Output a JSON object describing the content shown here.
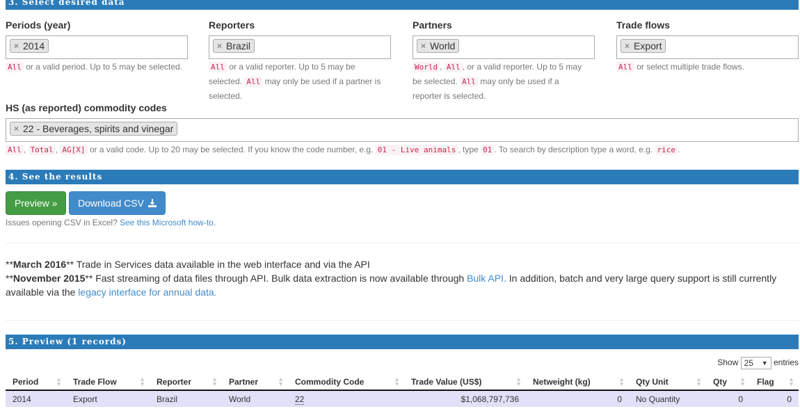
{
  "section3": {
    "title": "3. Select desired data"
  },
  "periods": {
    "label": "Periods (year)",
    "chip": "2014",
    "help_code": "All",
    "help_text": "or a valid period. Up to 5 may be selected."
  },
  "reporters": {
    "label": "Reporters",
    "chip": "Brazil",
    "help_code1": "All",
    "help_text1": "or a valid reporter. Up to 5 may be",
    "help_text2": "selected.",
    "help_code2": "All",
    "help_text3": "may only be used if a partner is",
    "help_text4": "selected."
  },
  "partners": {
    "label": "Partners",
    "chip": "World",
    "help_code1": "World",
    "help_sep1": ",",
    "help_code2": "All",
    "help_text1": ", or a valid reporter. Up to 5 may",
    "help_text2": "be selected.",
    "help_code3": "All",
    "help_text3": "may only be used if a",
    "help_text4": "reporter is selected."
  },
  "tradeflows": {
    "label": "Trade flows",
    "chip": "Export",
    "help_code": "All",
    "help_text": "or select multiple trade flows."
  },
  "hs": {
    "label": "HS (as reported) commodity codes",
    "chip": "22 - Beverages, spirits and vinegar",
    "help": {
      "c1": "All",
      "s1": ",",
      "c2": "Total",
      "s2": ",",
      "c3": "AG[X]",
      "t1": "or a valid code. Up to 20 may be selected. If you know the code number, e.g.",
      "c4": "01 - Live animals",
      "t2": ", type",
      "c5": "01",
      "t3": ". To search by description type a word, e.g.",
      "c6": "rice",
      "t4": "."
    }
  },
  "section4": {
    "title": "4. See the results"
  },
  "buttons": {
    "preview": "Preview »",
    "download": "Download CSV"
  },
  "csv_note": {
    "text": "Issues opening CSV in Excel?",
    "link": "See this Microsoft how-to."
  },
  "news": {
    "item1": {
      "prefix": "**",
      "date": "March 2016",
      "suffix": "** Trade in Services data available in the web interface and via the API"
    },
    "item2": {
      "prefix": "**",
      "date": "November 2015",
      "text1": "** Fast streaming of data files through API. Bulk data extraction is now available through",
      "link1": "Bulk API.",
      "text2": "In addition, batch and very large query support is still currently available via the",
      "link2": "legacy interface for annual data."
    }
  },
  "section5": {
    "title": "5. Preview (1 records)"
  },
  "table_controls": {
    "show": "Show",
    "page_size": "25",
    "entries": "entries"
  },
  "table": {
    "headers": [
      "Period",
      "Trade Flow",
      "Reporter",
      "Partner",
      "Commodity Code",
      "Trade Value (US$)",
      "Netweight (kg)",
      "Qty Unit",
      "Qty",
      "Flag"
    ],
    "rows": [
      [
        "2014",
        "Export",
        "Brazil",
        "World",
        "22",
        "$1,068,797,736",
        "0",
        "No Quantity",
        "0",
        "0"
      ]
    ]
  }
}
